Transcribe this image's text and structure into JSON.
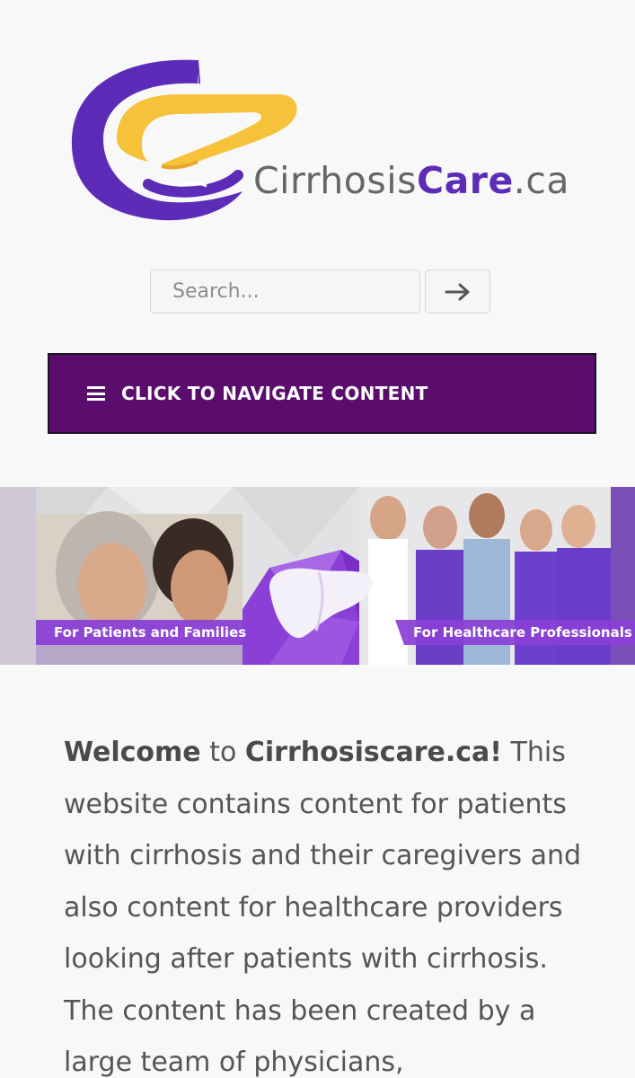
{
  "logo": {
    "text_regular": "Cirrhosis",
    "text_bold": "Care",
    "text_suffix": ".ca",
    "colors": {
      "purple": "#5c2bb8",
      "yellow": "#f5c23a",
      "gray": "#666666"
    }
  },
  "search": {
    "placeholder": "Search...",
    "submit_icon": "arrow-right-icon"
  },
  "nav": {
    "label": "CLICK TO NAVIGATE CONTENT",
    "icon": "hamburger-menu-icon",
    "background": "#5b0d6e"
  },
  "banner": {
    "patients_label": "For Patients and Families",
    "professionals_label": "For Healthcare Professionals",
    "accent": "#8a3fd6"
  },
  "intro": {
    "welcome": "Welcome",
    "to": " to ",
    "site": "Cirrhosiscare.ca!",
    "body": " This website contains content for patients with cirrhosis and their caregivers and also content for healthcare providers looking after patients with cirrhosis. The content has been created by a large team of physicians,"
  }
}
